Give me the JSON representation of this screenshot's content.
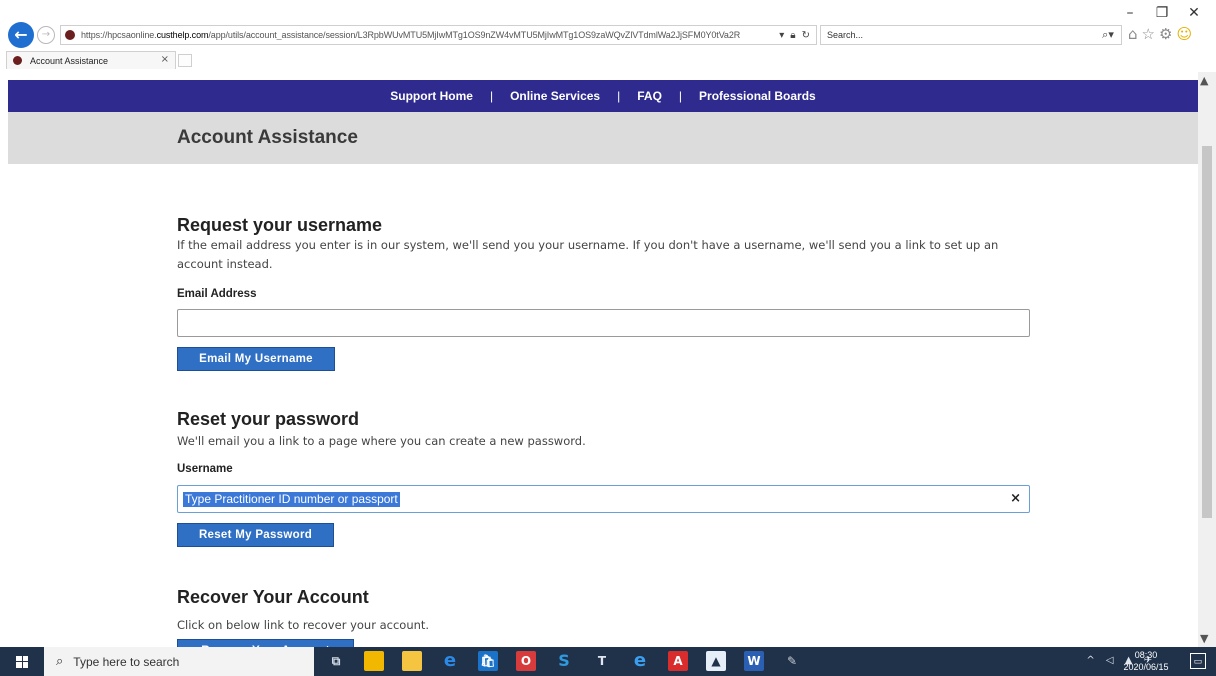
{
  "browser": {
    "url_host": "https://hpcsaonline.",
    "url_domain": "custhelp.com",
    "url_path": "/app/utils/account_assistance/session/L3RpbWUvMTU5MjIwMTg1OS9nZW4vMTU5MjIwMTg1OS9zaWQvZlVTdmlWa2JjSFM0Y0tVa2R",
    "search_placeholder": "Search...",
    "tab_title": "Account Assistance",
    "tab_close": "×"
  },
  "nav": {
    "items": [
      "Support Home",
      "Online Services",
      "FAQ",
      "Professional Boards"
    ],
    "separator": "|"
  },
  "page": {
    "title": "Account Assistance"
  },
  "username_section": {
    "heading": "Request your username",
    "description": "If the email address you enter is in our system, we'll send you your username. If you don't have a username, we'll send you a link to set up an account instead.",
    "field_label": "Email Address",
    "field_value": "",
    "button_label": "Email My Username"
  },
  "password_section": {
    "heading": "Reset your password",
    "description": "We'll email you a link to a page where you can create a new password.",
    "field_label": "Username",
    "field_value": "Type Practitioner ID number or passport",
    "clear_glyph": "×",
    "button_label": "Reset My Password"
  },
  "recover_section": {
    "heading": "Recover Your Account",
    "description": "Click on below link to recover your account.",
    "button_label": "Recover Your Account"
  },
  "taskbar": {
    "search_placeholder": "Type here to search",
    "time": "08:30",
    "date": "2020/06/15"
  },
  "colors": {
    "nav_bg": "#2e2a8e",
    "header_band": "#dcdcdc",
    "button": "#2f6fc4",
    "taskbar": "#20314a"
  }
}
